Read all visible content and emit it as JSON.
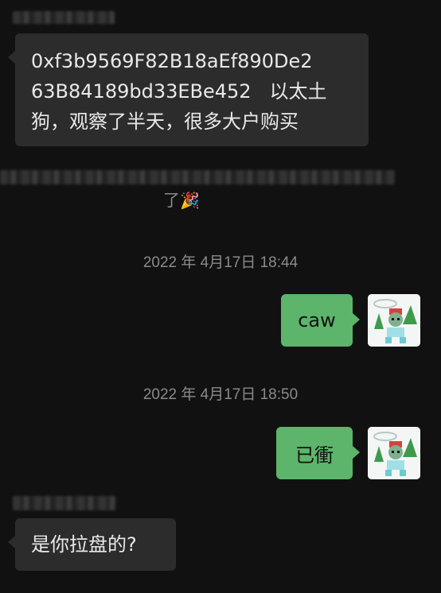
{
  "messages": {
    "msg1": {
      "text_line1": "0xf3b9569F82B18aEf890De2",
      "text_line2": "63B84189bd33EBe452   以太土",
      "text_line3": "狗，观察了半天，很多大户购买"
    },
    "system": {
      "tail_text": "了",
      "emoji": "🎉"
    },
    "timestamp1": "2022 年 4月17日 18:44",
    "msg2": {
      "text": "caw"
    },
    "timestamp2": "2022 年 4月17日 18:50",
    "msg3": {
      "text": "已衝"
    },
    "msg4": {
      "text": "是你拉盘的?"
    }
  },
  "colors": {
    "background": "#111111",
    "incoming_bubble": "#2c2c2c",
    "outgoing_bubble": "#5cb56a",
    "timestamp_text": "#8a8a8a"
  }
}
